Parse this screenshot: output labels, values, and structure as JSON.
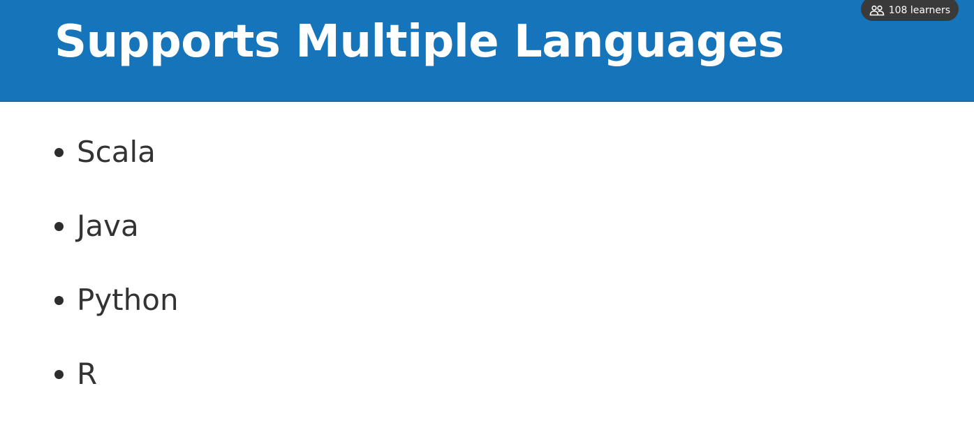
{
  "slide": {
    "title": "Supports Multiple Languages",
    "bullets": [
      {
        "text": "Scala"
      },
      {
        "text": "Java"
      },
      {
        "text": "Python"
      },
      {
        "text": "R"
      }
    ]
  },
  "badge": {
    "icon": "learners-icon",
    "label": "108 learners"
  },
  "colors": {
    "header_background": "#1674bb",
    "title_text": "#ffffff",
    "body_text": "#333333",
    "badge_background": "#3a3a3a"
  }
}
